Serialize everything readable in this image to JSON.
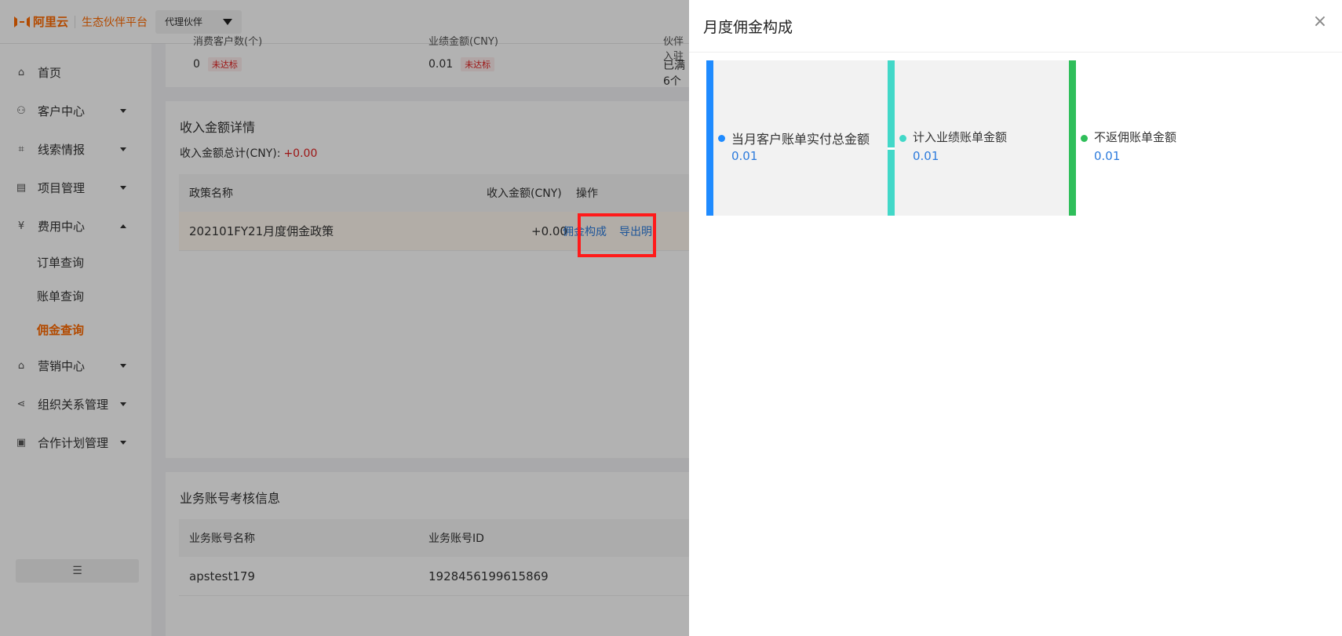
{
  "topbar": {
    "logo_text": "阿里云",
    "platform": "生态伙伴平台",
    "role": "代理伙伴"
  },
  "sidebar": {
    "items": [
      {
        "label": "首页",
        "icon": "home-icon"
      },
      {
        "label": "客户中心",
        "icon": "users-icon"
      },
      {
        "label": "线索情报",
        "icon": "leads-icon"
      },
      {
        "label": "项目管理",
        "icon": "project-icon"
      },
      {
        "label": "费用中心",
        "icon": "fee-icon"
      },
      {
        "label": "营销中心",
        "icon": "bag-icon"
      },
      {
        "label": "组织关系管理",
        "icon": "share-icon"
      },
      {
        "label": "合作计划管理",
        "icon": "calendar-icon"
      }
    ],
    "sub_items": [
      "订单查询",
      "账单查询",
      "佣金查询"
    ],
    "collapse_icon": "collapse-icon"
  },
  "stats": {
    "consumer_label": "消费客户数(个)",
    "consumer_value": "0",
    "consumer_tag": "未达标",
    "performance_label": "业绩金额(CNY)",
    "performance_value": "0.01",
    "performance_tag": "未达标",
    "partner_label": "伙伴入驻",
    "partner_value": "已满6个"
  },
  "income": {
    "title": "收入金额详情",
    "total_label": "收入金额总计(CNY):",
    "total_value": "+0.00",
    "headers": {
      "policy": "政策名称",
      "amount": "收入金额(CNY)",
      "action": "操作"
    },
    "rows": [
      {
        "policy": "202101FY21月度佣金政策",
        "amount": "+0.00",
        "action1": "佣金构成",
        "action2": "导出明"
      }
    ]
  },
  "account": {
    "title": "业务账号考核信息",
    "headers": {
      "name": "业务账号名称",
      "id": "业务账号ID"
    },
    "rows": [
      {
        "name": "apstest179",
        "id": "1928456199615869"
      }
    ]
  },
  "drawer": {
    "title": "月度佣金构成",
    "close_icon": "close-icon",
    "components": [
      {
        "label": "当月客户账单实付总金额",
        "value": "0.01",
        "color": "#1f8bff"
      },
      {
        "label": "计入业绩账单金额",
        "value": "0.01",
        "color": "#42d8c8"
      },
      {
        "label": "不返佣账单金额",
        "value": "0.01",
        "color": "#2fbe5a"
      }
    ]
  }
}
